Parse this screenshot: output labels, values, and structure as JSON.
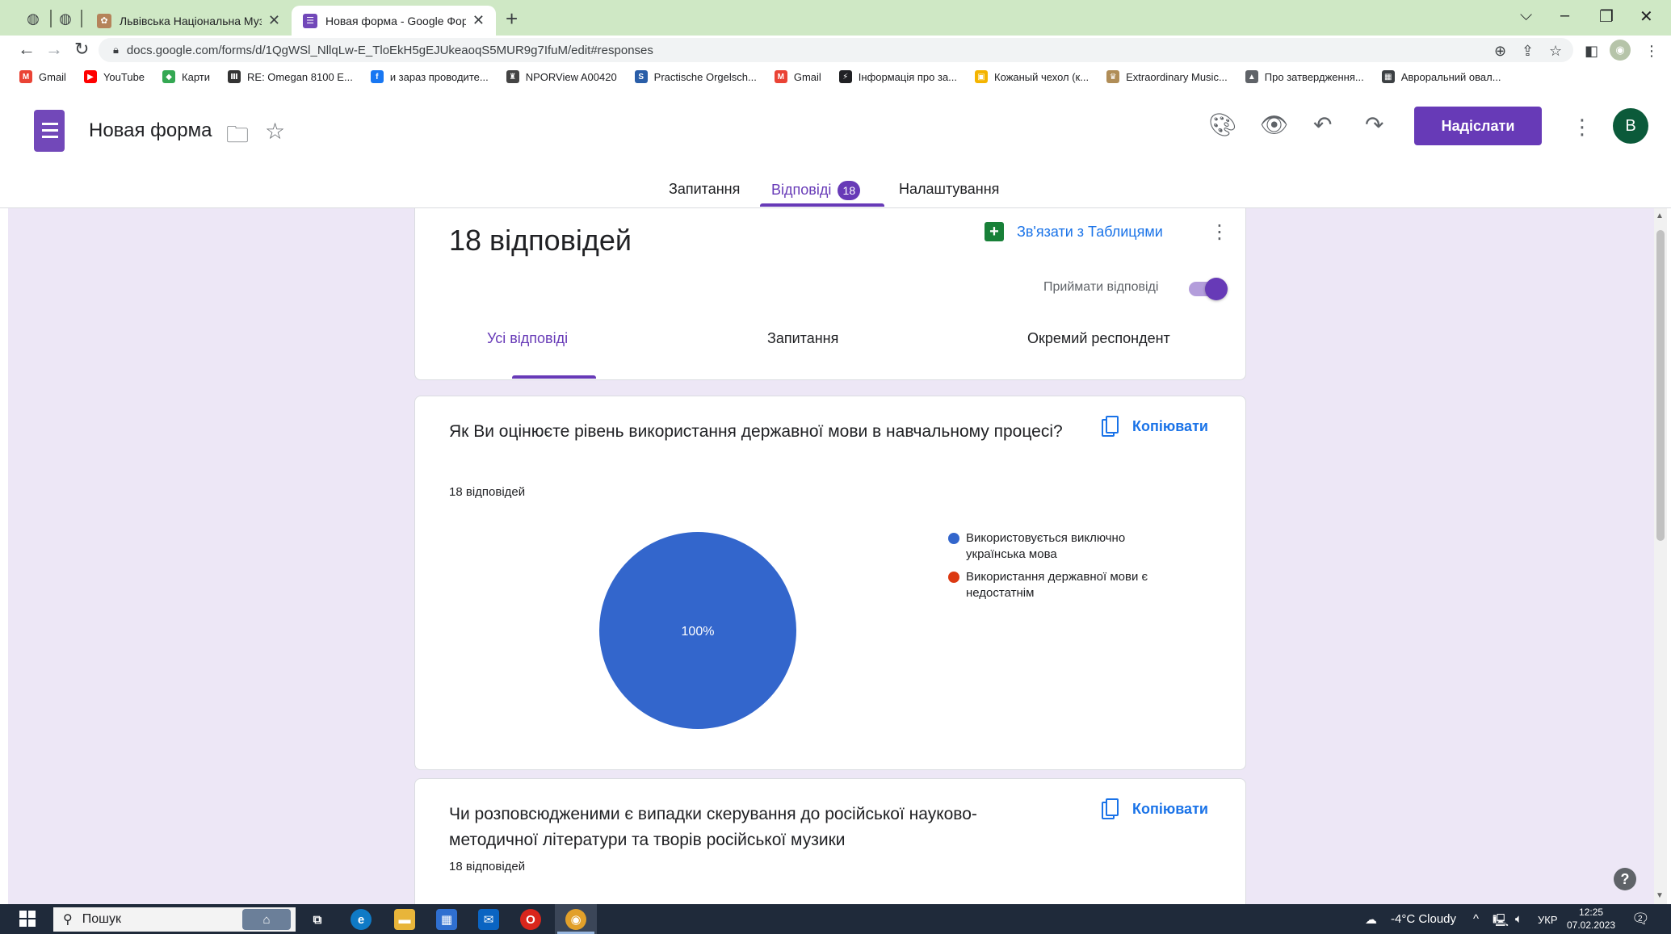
{
  "browser": {
    "tabs": [
      {
        "title": "Львівська Національна Музична",
        "active": false
      },
      {
        "title": "Новая форма - Google Формы",
        "active": true
      }
    ],
    "url": "docs.google.com/forms/d/1QgWSl_NllqLw-E_TloEkH5gEJUkeaoqS5MUR9g7IfuM/edit#responses",
    "bookmarks": [
      {
        "label": "Gmail",
        "color": "#ea4335",
        "glyph": "M"
      },
      {
        "label": "YouTube",
        "color": "#ff0000",
        "glyph": "▶"
      },
      {
        "label": "Карти",
        "color": "#34a853",
        "glyph": "◆"
      },
      {
        "label": "RE: Omegan 8100 E...",
        "color": "#333333",
        "glyph": "Ⅲ"
      },
      {
        "label": "и зараз проводите...",
        "color": "#1877f2",
        "glyph": "f"
      },
      {
        "label": "NPORView A00420",
        "color": "#444444",
        "glyph": "♜"
      },
      {
        "label": "Practische Orgelsch...",
        "color": "#2a5ea8",
        "glyph": "S"
      },
      {
        "label": "Gmail",
        "color": "#ea4335",
        "glyph": "M"
      },
      {
        "label": "Інформація про за...",
        "color": "#202124",
        "glyph": "⚡"
      },
      {
        "label": "Кожаный чехол (к...",
        "color": "#f4b400",
        "glyph": "▣"
      },
      {
        "label": "Extraordinary Music...",
        "color": "#b08d57",
        "glyph": "♛"
      },
      {
        "label": "Про затвердження...",
        "color": "#5f6368",
        "glyph": "▲"
      },
      {
        "label": "Авроральний овал...",
        "color": "#3c4043",
        "glyph": "▦"
      }
    ]
  },
  "header": {
    "form_title": "Новая форма",
    "send_label": "Надіслати",
    "avatar_letter": "B",
    "tabs": [
      {
        "label": "Запитання"
      },
      {
        "label": "Відповіді",
        "badge": "18"
      },
      {
        "label": "Налаштування"
      }
    ]
  },
  "summary": {
    "title": "18 відповідей",
    "link_label": "Зв'язати з Таблицями",
    "accept_label": "Приймати відповіді",
    "accepting": true,
    "subtabs": [
      "Усі відповіді",
      "Запитання",
      "Окремий респондент"
    ]
  },
  "questions": [
    {
      "title": "Як Ви оцінюєте рівень використання державної мови в навчальному процесі?",
      "count": "18 відповідей",
      "copy_label": "Копіювати"
    },
    {
      "title": "Чи розповсюдженими є випадки скерування до російської науково-методичної літератури та творів російської музики",
      "count": "18 відповідей",
      "copy_label": "Копіювати"
    }
  ],
  "chart_data": {
    "type": "pie",
    "categories": [
      "Використовується виключно українська мова",
      "Використання державної мови є недостатнім"
    ],
    "values": [
      100,
      0
    ],
    "colors": [
      "#3366cc",
      "#dc3912"
    ],
    "data_labels": [
      "100%"
    ],
    "legend_position": "right"
  },
  "taskbar": {
    "search_label": "Пошук",
    "weather": "-4°C  Cloudy",
    "lang": "УКР",
    "time": "12:25",
    "date": "07.02.2023",
    "notif_count": "2"
  },
  "colors": {
    "accent": "#673ab7",
    "content_bg": "#ede7f6",
    "link": "#1a73e8",
    "tabstrip": "#cfe8c5"
  }
}
